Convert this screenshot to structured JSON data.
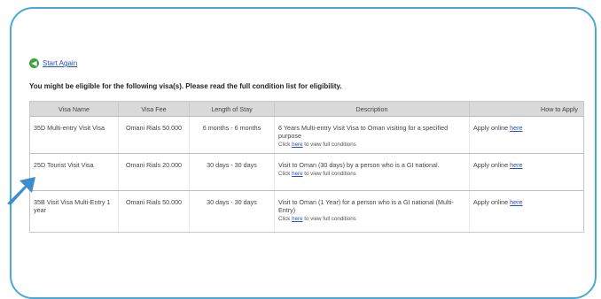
{
  "nav": {
    "start_again": "Start Again"
  },
  "intro": "You might be eligible for the following visa(s). Please read the full condition list for eligibility.",
  "table": {
    "headers": [
      "Visa Name",
      "Visa Fee",
      "Length of Stay",
      "Description",
      "How to Apply"
    ],
    "rows": [
      {
        "name": "35D Multi-entry Visit Visa",
        "fee": "Omani Rials 50.000",
        "stay": "6 months - 6 months",
        "description": "6 Years Multi-entry Visit Visa to Oman visiting for a specified purpose",
        "desc_prefix": "Click",
        "desc_link": "here",
        "desc_suffix": "to view full conditions",
        "apply_text": "Apply online",
        "apply_link": "here"
      },
      {
        "name": "25D Tourist Visit Visa",
        "fee": "Omani Rials 20.000",
        "stay": "30 days - 30 days",
        "description": "Visit to Oman (30 days) by a person who is a GI national.",
        "desc_prefix": "Click",
        "desc_link": "here",
        "desc_suffix": "to view full conditions",
        "apply_text": "Apply online",
        "apply_link": "here"
      },
      {
        "name": "35B Visit Visa Multi-Entry 1 year",
        "fee": "Omani Rials 50.000",
        "stay": "30 days - 30 days",
        "description": "Visit to Oman (1 Year) for a person who is a GI national (Multi-Entry)",
        "desc_prefix": "Click",
        "desc_link": "here",
        "desc_suffix": "to view full conditions",
        "apply_text": "Apply online",
        "apply_link": "here"
      }
    ]
  },
  "colors": {
    "frame": "#4aa8d8",
    "arrow": "#3d8ed1",
    "link": "#2b4fc4",
    "header_bg": "#d9d9d9"
  }
}
